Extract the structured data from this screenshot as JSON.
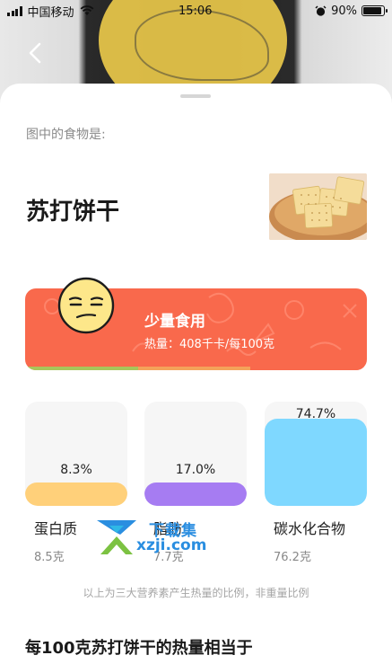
{
  "status_bar": {
    "carrier": "中国移动",
    "time": "15:06",
    "battery_percent": "90%",
    "battery_level": 0.9,
    "icons": [
      "signal-icon",
      "wifi-icon",
      "alarm-icon",
      "battery-icon"
    ]
  },
  "nav": {
    "back_icon": "chevron-left-icon"
  },
  "recognition": {
    "prompt": "图中的食物是:",
    "food_name": "苏打饼干"
  },
  "advice": {
    "title": "少量食用",
    "calories_text": "热量：408千卡/每100克",
    "emoji_icon": "smirk-face-icon",
    "card_color": "#f9694c"
  },
  "macros": [
    {
      "name": "蛋白质",
      "percent_text": "8.3%",
      "weight": "8.5克",
      "fill_fraction": 0.083,
      "color": "#ffd07a"
    },
    {
      "name": "脂肪",
      "percent_text": "17.0%",
      "weight": "7.7克",
      "fill_fraction": 0.17,
      "color": "#a67cf2"
    },
    {
      "name": "碳水化合物",
      "percent_text": "74.7%",
      "weight": "76.2克",
      "fill_fraction": 0.747,
      "color": "#7fd8ff"
    }
  ],
  "note": "以上为三大营养素产生热量的比例，非重量比例",
  "section_title": "每100克苏打饼干的热量相当于",
  "watermark": {
    "name": "下载集",
    "site": "xzji.com"
  }
}
